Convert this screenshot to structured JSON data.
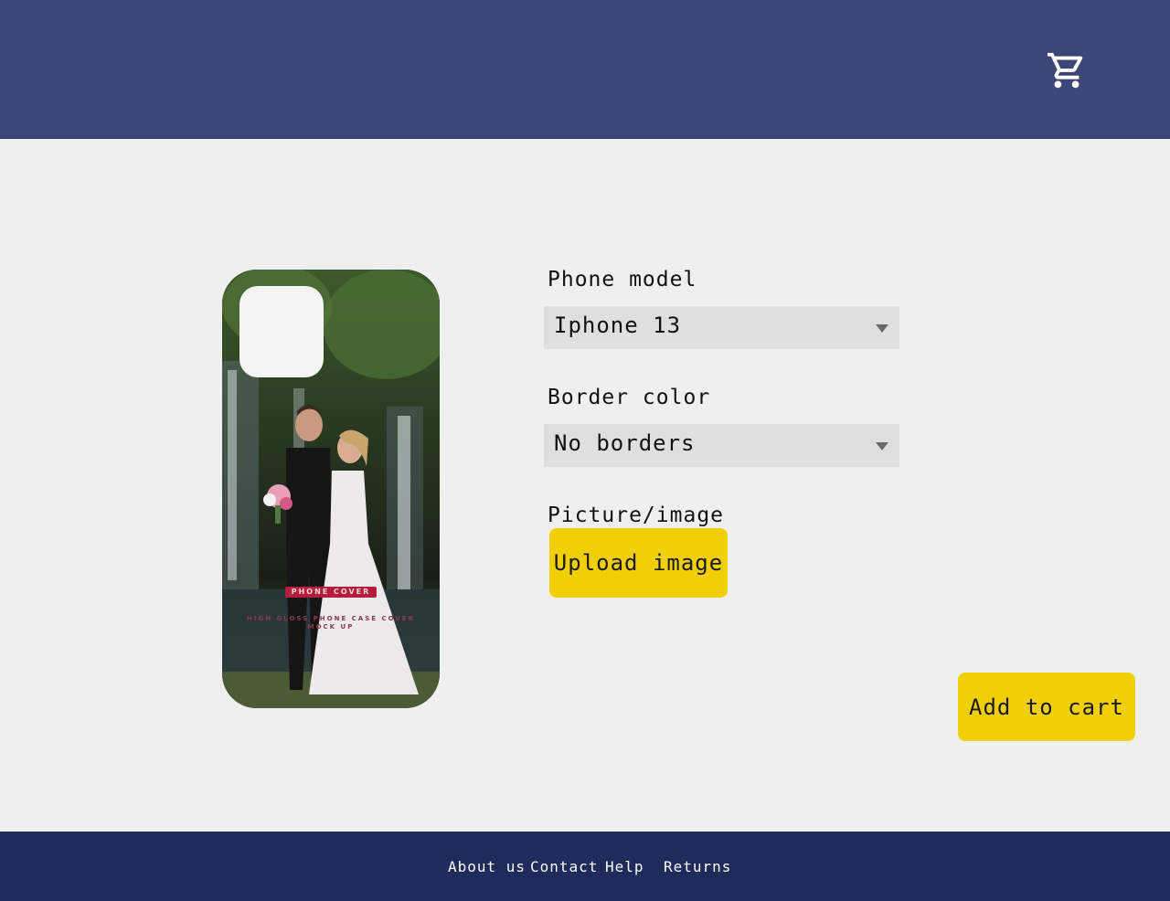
{
  "header": {
    "cart_icon": "shopping-cart-icon"
  },
  "preview": {
    "badge_text": "PHONE COVER",
    "sub_text": "HIGH GLOSS PHONE CASE COVER MOCK UP"
  },
  "form": {
    "phone_model_label": "Phone model",
    "phone_model_value": "Iphone 13",
    "border_color_label": "Border color",
    "border_color_value": "No borders",
    "picture_label": "Picture/image",
    "upload_button": "Upload image",
    "add_to_cart_button": "Add to cart"
  },
  "footer": {
    "links": [
      "About us",
      "Contact",
      "Help",
      "Returns"
    ]
  },
  "colors": {
    "header": "#3d4777",
    "footer": "#1f2c5b",
    "accent": "#f0cf05",
    "background": "#efefef"
  }
}
